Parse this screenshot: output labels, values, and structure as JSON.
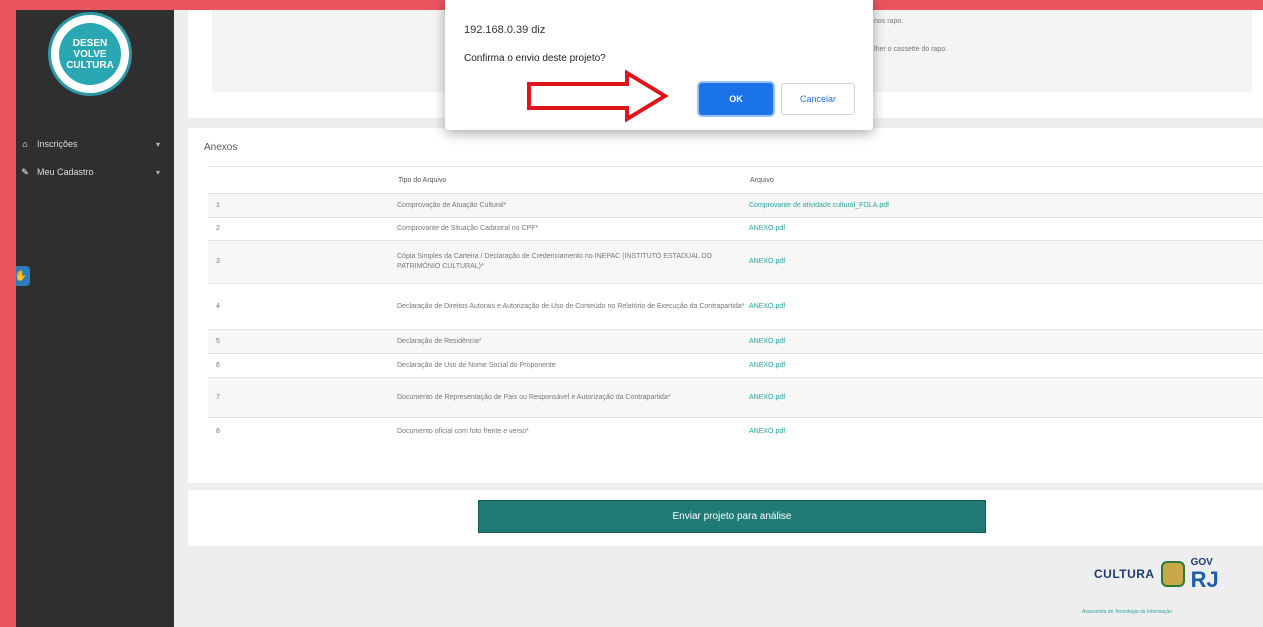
{
  "sidebar": {
    "logo_text": "DESEN\nVOLVE\nCULTURA",
    "items": [
      {
        "label": "Inscrições",
        "icon": "home-icon"
      },
      {
        "label": "Meu Cadastro",
        "icon": "edit-icon"
      }
    ]
  },
  "top_panel": {
    "text1": "nos rapo.",
    "text2": "lher o cassette do rapo."
  },
  "anexos": {
    "title": "Anexos",
    "headers": [
      "",
      "Tipo do Arquivo",
      "Arquivo"
    ],
    "rows": [
      {
        "num": "1",
        "tipo": "Comprovação de Atuação Cultural*",
        "arquivo": "Comprovante de atividade cultural_FOLA.pdf"
      },
      {
        "num": "2",
        "tipo": "Comprovante de Situação Cadastral no CPF*",
        "arquivo": "ANEXO.pdf"
      },
      {
        "num": "3",
        "tipo": "Cópia Simples da Carteira / Declaração de Credenciamento no INEPAC (INSTITUTO ESTADUAL DO PATRIMÔNIO CULTURAL)*",
        "arquivo": "ANEXO.pdf"
      },
      {
        "num": "4",
        "tipo": "Declaração de Direitos Autorais e Autorização de Uso de Conteúdo no Relatório de Execução da Contrapartida*",
        "arquivo": "ANEXO.pdf"
      },
      {
        "num": "5",
        "tipo": "Declaração de Residência*",
        "arquivo": "ANEXO.pdf"
      },
      {
        "num": "6",
        "tipo": "Declaração de Uso de Nome Social do Proponente",
        "arquivo": "ANEXO.pdf"
      },
      {
        "num": "7",
        "tipo": "Documento de Representação de Pais ou Responsável e Autorização da Contrapartida*",
        "arquivo": "ANEXO.pdf"
      },
      {
        "num": "8",
        "tipo": "Documento oficial com foto frente e verso*",
        "arquivo": "ANEXO.pdf"
      }
    ]
  },
  "send_button": "Enviar projeto para análise",
  "footer": {
    "cultura": "CULTURA",
    "gov": "GOV",
    "rj": "RJ",
    "sub": "Assessoria de Tecnologia da Informação"
  },
  "dialog": {
    "title": "192.168.0.39 diz",
    "message": "Confirma o envio deste projeto?",
    "ok": "OK",
    "cancel": "Cancelar"
  },
  "colors": {
    "frame_border": "#e9545f",
    "sidebar": "#2f2f2f",
    "send_button": "#1f7a76",
    "ok_button": "#1a73e8",
    "arrow": "#e0151b",
    "link": "#2aa59c"
  }
}
